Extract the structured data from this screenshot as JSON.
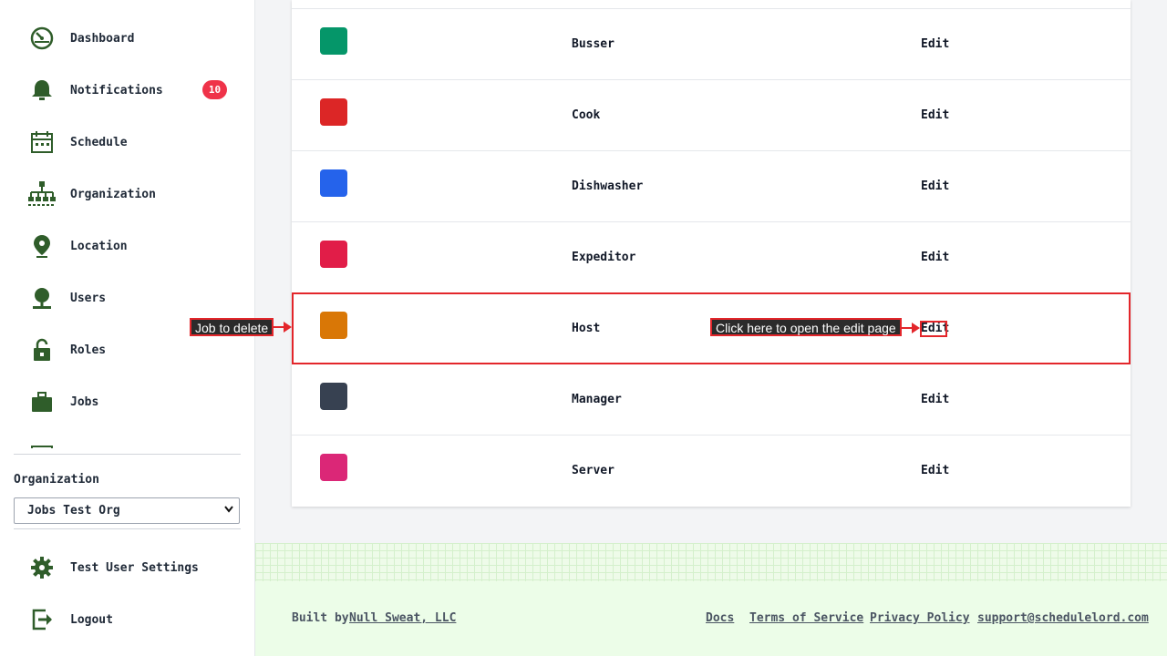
{
  "sidebar": {
    "items": [
      {
        "label": "Dashboard",
        "icon": "dashboard-icon"
      },
      {
        "label": "Notifications",
        "icon": "bell-icon",
        "badge": "10"
      },
      {
        "label": "Schedule",
        "icon": "calendar-icon"
      },
      {
        "label": "Organization",
        "icon": "org-chart-icon"
      },
      {
        "label": "Location",
        "icon": "location-pin-icon"
      },
      {
        "label": "Users",
        "icon": "users-icon"
      },
      {
        "label": "Roles",
        "icon": "unlock-icon"
      },
      {
        "label": "Jobs",
        "icon": "briefcase-icon"
      }
    ],
    "organization_label": "Organization",
    "organization_selected": "Jobs Test Org",
    "settings_label": "Test User Settings",
    "logout_label": "Logout"
  },
  "jobs": [
    {
      "name": "Busser",
      "color": "#059669",
      "edit_label": "Edit"
    },
    {
      "name": "Cook",
      "color": "#dc2626",
      "edit_label": "Edit"
    },
    {
      "name": "Dishwasher",
      "color": "#2563eb",
      "edit_label": "Edit"
    },
    {
      "name": "Expeditor",
      "color": "#e11d48",
      "edit_label": "Edit"
    },
    {
      "name": "Host",
      "color": "#d97706",
      "edit_label": "Edit"
    },
    {
      "name": "Manager",
      "color": "#374151",
      "edit_label": "Edit"
    },
    {
      "name": "Server",
      "color": "#db2777",
      "edit_label": "Edit"
    }
  ],
  "annotations": {
    "job_to_delete": "Job to delete",
    "edit_hint": "Click here to open the edit page"
  },
  "footer": {
    "built_by_prefix": "Built by",
    "company": "Null Sweat, LLC",
    "links": [
      "Docs",
      "Terms of Service",
      "Privacy Policy",
      "support@schedulelord.com"
    ]
  },
  "colors": {
    "icon_green": "#2f5d2a",
    "badge_red": "#ef3349",
    "annotation_red": "#e3262b"
  }
}
